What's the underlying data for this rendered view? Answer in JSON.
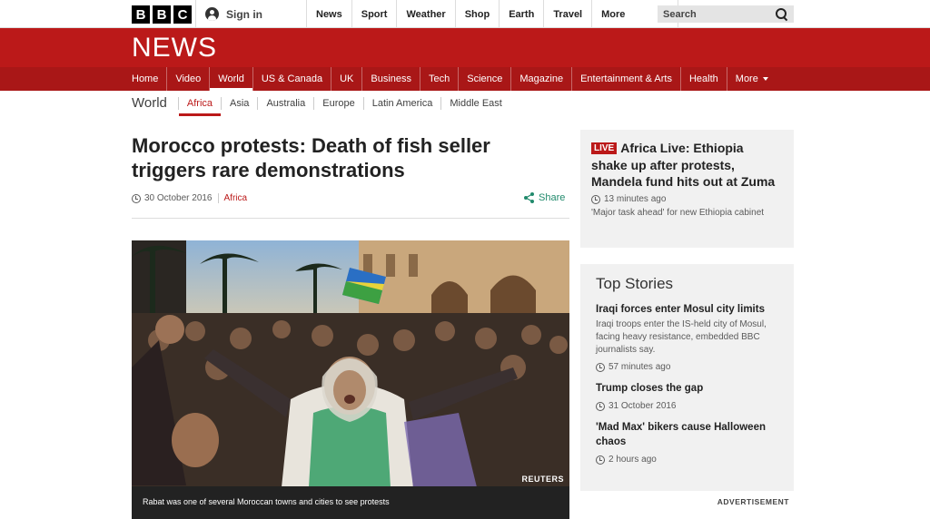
{
  "masthead": {
    "logo_letters": [
      "B",
      "B",
      "C"
    ],
    "signin_label": "Sign in",
    "nav": [
      "News",
      "Sport",
      "Weather",
      "Shop",
      "Earth",
      "Travel"
    ],
    "more_label": "More",
    "search_placeholder": "Search"
  },
  "banner": {
    "title": "NEWS"
  },
  "main_nav": {
    "items": [
      "Home",
      "Video",
      "World",
      "US & Canada",
      "UK",
      "Business",
      "Tech",
      "Science",
      "Magazine",
      "Entertainment & Arts",
      "Health"
    ],
    "active": "World",
    "more_label": "More"
  },
  "sub_nav": {
    "section": "World",
    "items": [
      "Africa",
      "Asia",
      "Australia",
      "Europe",
      "Latin America",
      "Middle East"
    ],
    "active": "Africa"
  },
  "article": {
    "headline": "Morocco protests: Death of fish seller triggers rare demonstrations",
    "date": "30 October 2016",
    "tag": "Africa",
    "share_label": "Share",
    "photo_credit": "REUTERS",
    "caption": "Rabat was one of several Moroccan towns and cities to see protests"
  },
  "live": {
    "badge": "LIVE",
    "title": "Africa Live: Ethiopia shake up after protests, Mandela fund hits out at Zuma",
    "time": "13 minutes ago",
    "summary": "'Major task ahead' for new Ethiopia cabinet"
  },
  "top_stories": {
    "heading": "Top Stories",
    "items": [
      {
        "title": "Iraqi forces enter Mosul city limits",
        "summary": "Iraqi troops enter the IS-held city of Mosul, facing heavy resistance, embedded BBC journalists say.",
        "time": "57 minutes ago"
      },
      {
        "title": "Trump closes the gap",
        "time": "31 October 2016"
      },
      {
        "title": "'Mad Max' bikers cause Halloween chaos",
        "time": "2 hours ago"
      }
    ]
  },
  "advertisement_label": "ADVERTISEMENT",
  "colors": {
    "brand_red": "#bb1919",
    "nav_red": "#a91717",
    "share_green": "#218a6c"
  }
}
